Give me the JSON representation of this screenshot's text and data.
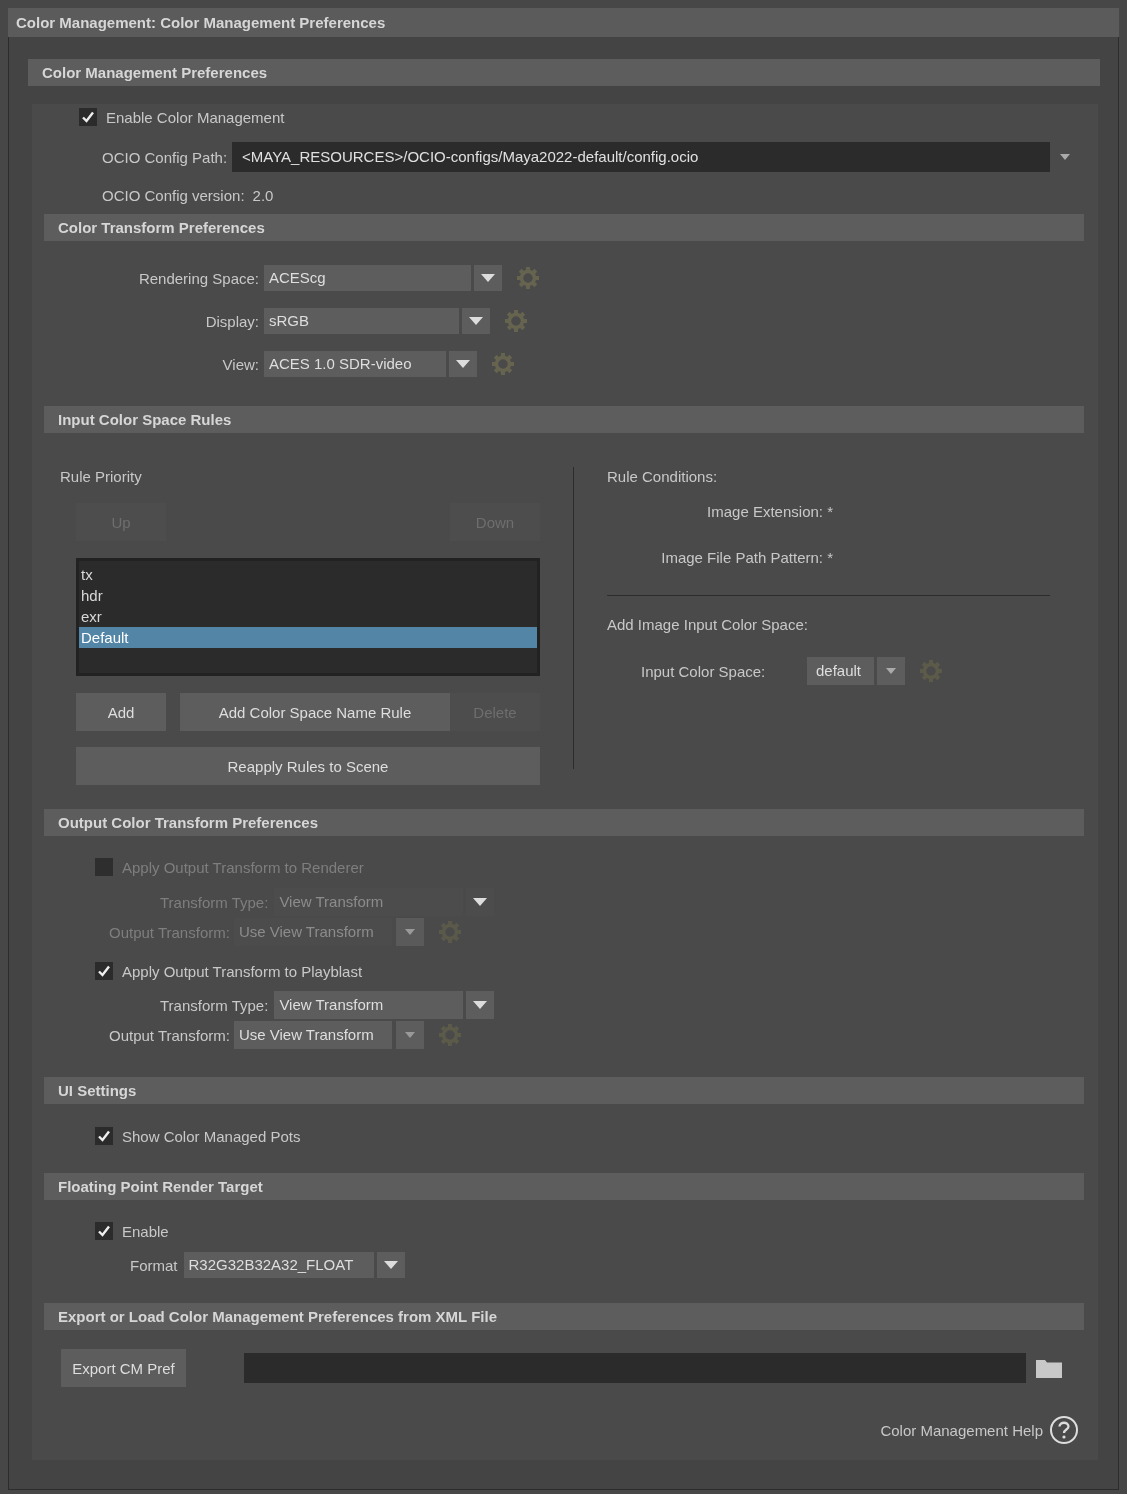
{
  "window": {
    "title": "Color Management: Color Management Preferences"
  },
  "panel": {
    "title": "Color Management Preferences"
  },
  "enable_color_management": {
    "label": "Enable Color Management",
    "checked": true
  },
  "ocio_config_path": {
    "label": "OCIO Config Path:",
    "value": "<MAYA_RESOURCES>/OCIO-configs/Maya2022-default/config.ocio"
  },
  "ocio_config_version": {
    "label": "OCIO Config version:",
    "value": "2.0"
  },
  "color_transform": {
    "title": "Color Transform Preferences",
    "fields": [
      {
        "label": "Rendering Space:",
        "value": "ACEScg"
      },
      {
        "label": "Display:",
        "value": "sRGB"
      },
      {
        "label": "View:",
        "value": "ACES 1.0 SDR-video"
      }
    ]
  },
  "input_rules": {
    "title": "Input Color Space Rules",
    "rule_priority": "Rule Priority",
    "move_buttons": [
      {
        "label": "Up",
        "disabled": true
      },
      {
        "label": "Down",
        "disabled": true
      }
    ],
    "rules": [
      {
        "label": "tx",
        "selected": false
      },
      {
        "label": "hdr",
        "selected": false
      },
      {
        "label": "exr",
        "selected": false
      },
      {
        "label": "Default",
        "selected": true
      }
    ],
    "action_buttons": [
      {
        "label": "Add",
        "disabled": false
      },
      {
        "label": "Add Color Space Name Rule",
        "disabled": false
      },
      {
        "label": "Delete",
        "disabled": true
      }
    ],
    "reapply_button": "Reapply Rules to Scene",
    "conditions_title": "Rule Conditions:",
    "conditions": [
      {
        "label": "Image Extension: *"
      },
      {
        "label": "Image File Path Pattern: *"
      }
    ],
    "add_title": "Add Image Input Color Space:",
    "input_color_space": {
      "label": "Input Color Space:",
      "value": "default"
    }
  },
  "output_transform": {
    "title": "Output Color Transform Preferences",
    "groups": [
      {
        "label": "Apply Output Transform to Renderer",
        "checked": false,
        "disabled": true,
        "transform_type": {
          "label": "Transform Type:",
          "value": "View Transform"
        },
        "output_transform": {
          "label": "Output Transform:",
          "value": "Use View Transform"
        }
      },
      {
        "label": "Apply Output Transform to Playblast",
        "checked": true,
        "disabled": false,
        "transform_type": {
          "label": "Transform Type:",
          "value": "View Transform"
        },
        "output_transform": {
          "label": "Output Transform:",
          "value": "Use View Transform"
        }
      }
    ]
  },
  "ui_settings": {
    "title": "UI Settings",
    "show_pots": {
      "label": "Show Color Managed Pots",
      "checked": true
    }
  },
  "float_target": {
    "title": "Floating Point Render Target",
    "enable": {
      "label": "Enable",
      "checked": true
    },
    "format": {
      "label": "Format",
      "value": "R32G32B32A32_FLOAT"
    }
  },
  "export": {
    "title": "Export or Load Color Management Preferences from XML File",
    "button": "Export CM Pref"
  },
  "help": {
    "label": "Color Management Help"
  }
}
